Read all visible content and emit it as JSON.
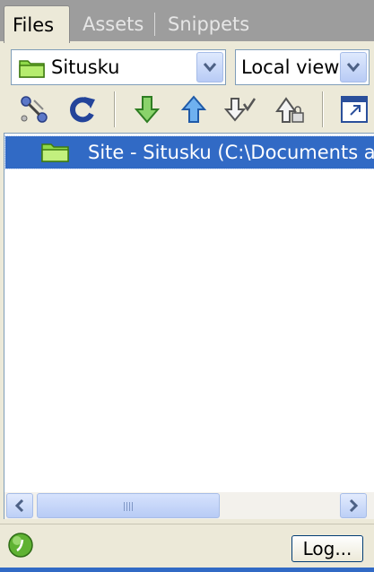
{
  "tabs": [
    {
      "label": "Files"
    },
    {
      "label": "Assets"
    },
    {
      "label": "Snippets"
    }
  ],
  "site_select": {
    "value": "Situsku"
  },
  "view_select": {
    "value": "Local view"
  },
  "toolbar": {
    "icons": [
      "connect-icon",
      "refresh-icon",
      "get-files-icon",
      "put-files-icon",
      "check-out-icon",
      "check-in-icon",
      "expand-icon"
    ]
  },
  "tree": {
    "items": [
      {
        "label": "Site - Situsku (C:\\Documents and",
        "selected": true
      }
    ]
  },
  "statusbar": {
    "log_label": "Log..."
  },
  "colors": {
    "selection": "#316ac5",
    "tab_strip": "#9d9d9d",
    "panel_bg": "#ece9d8",
    "folder": "#8fd94a"
  }
}
